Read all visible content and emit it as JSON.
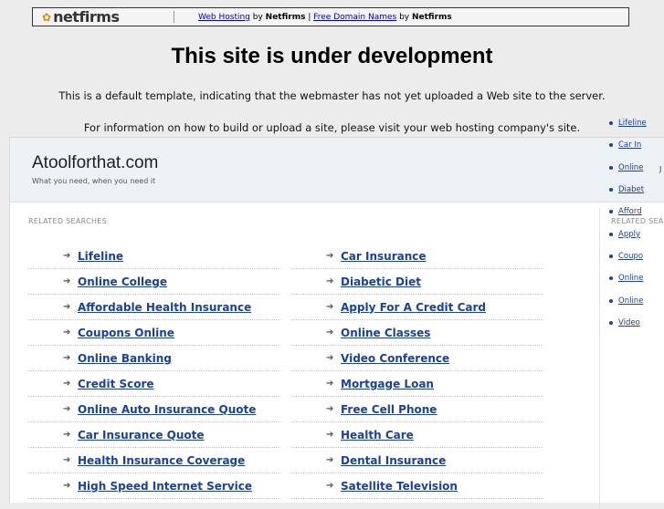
{
  "topbar": {
    "logo_text": "netfirms",
    "link1": "Web Hosting",
    "by1": " by ",
    "brand1": "Netfirms",
    "pipe": " | ",
    "link2": "Free Domain Names",
    "by2": " by ",
    "brand2": "Netfirms"
  },
  "notice": {
    "title": "This site is under development",
    "line1": "This is a default template, indicating that the webmaster has not yet uploaded a Web site to the server.",
    "line2": "For information on how to build or upload a site, please visit your web hosting company's site."
  },
  "site": {
    "name": "Atoolforthat.com",
    "tagline": "What you need, when you need it",
    "header_right": "J"
  },
  "related": {
    "label": "RELATED SEARCHES",
    "side_label": "RELATED SEA",
    "col1": [
      "Lifeline",
      "Online College",
      "Affordable Health Insurance",
      "Coupons Online",
      "Online Banking",
      "Credit Score",
      "Online Auto Insurance Quote",
      "Car Insurance Quote",
      "Health Insurance Coverage",
      "High Speed Internet Service"
    ],
    "col2": [
      "Car Insurance",
      "Diabetic Diet",
      "Apply For A Credit Card",
      "Online Classes",
      "Video Conference",
      "Mortgage Loan",
      "Free Cell Phone",
      "Health Care",
      "Dental Insurance",
      "Satellite Television"
    ],
    "side": [
      "Lifeline",
      "Car In",
      "Online",
      "Diabet",
      "Afford",
      "Apply",
      "Coupo",
      "Online",
      "Online",
      "Video"
    ]
  },
  "colors": {
    "link": "#1a40a6",
    "header_bg": "#edf2f6",
    "page_bg": "#ececec"
  }
}
